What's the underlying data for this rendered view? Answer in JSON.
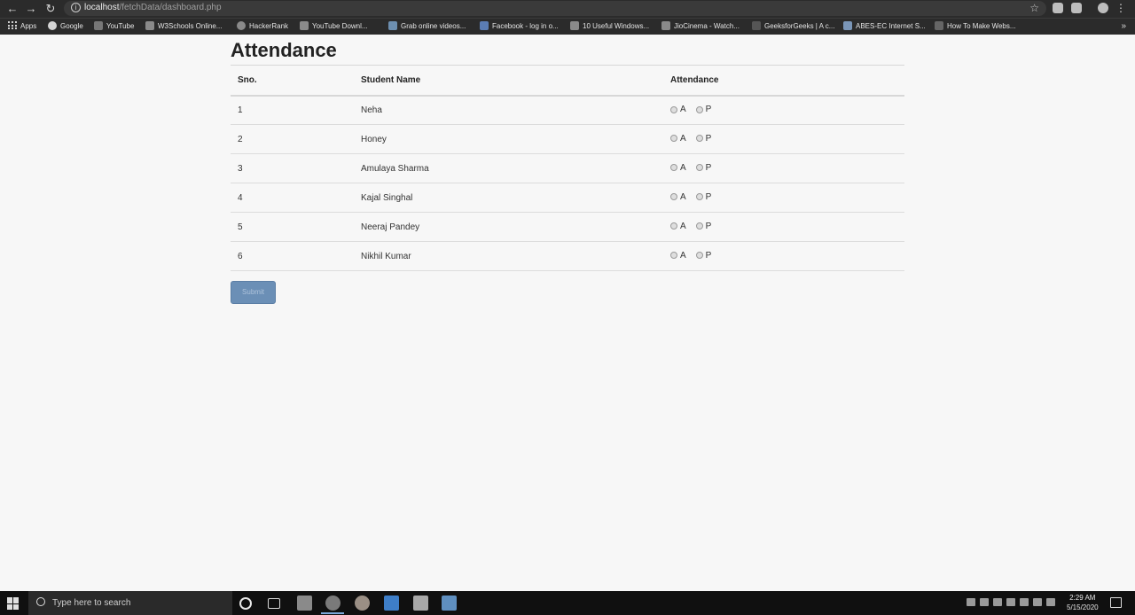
{
  "browser": {
    "url_host": "localhost",
    "url_path": "/fetchData/dashboard.php",
    "back_icon": "arrow-left-icon",
    "forward_icon": "arrow-right-icon",
    "reload_icon": "reload-icon",
    "bookmarks": [
      {
        "label": "Apps"
      },
      {
        "label": "Google"
      },
      {
        "label": "YouTube"
      },
      {
        "label": "W3Schools Online..."
      },
      {
        "label": "HackerRank"
      },
      {
        "label": "YouTube Downl..."
      },
      {
        "label": "Grab online videos..."
      },
      {
        "label": "Facebook - log in o..."
      },
      {
        "label": "10 Useful Windows..."
      },
      {
        "label": "JioCinema - Watch..."
      },
      {
        "label": "GeeksforGeeks | A c..."
      },
      {
        "label": "ABES-EC Internet S..."
      },
      {
        "label": "How To Make Webs..."
      }
    ],
    "more_bookmarks": "»"
  },
  "page": {
    "title": "Attendance",
    "table": {
      "headers": {
        "sno": "Sno.",
        "name": "Student Name",
        "attendance": "Attendance"
      },
      "option_a": "A",
      "option_p": "P",
      "rows": [
        {
          "sno": "1",
          "name": "Neha"
        },
        {
          "sno": "2",
          "name": "Honey"
        },
        {
          "sno": "3",
          "name": "Amulaya Sharma"
        },
        {
          "sno": "4",
          "name": "Kajal Singhal"
        },
        {
          "sno": "5",
          "name": "Neeraj Pandey"
        },
        {
          "sno": "6",
          "name": "Nikhil Kumar"
        }
      ]
    },
    "submit_label": "Submit"
  },
  "taskbar": {
    "search_placeholder": "Type here to search",
    "time": "2:29 AM",
    "date": "5/15/2020"
  },
  "colors": {
    "submit_bg": "#6b8fb6",
    "chrome_bg": "#2b2b2b",
    "page_bg": "#f7f7f7"
  }
}
